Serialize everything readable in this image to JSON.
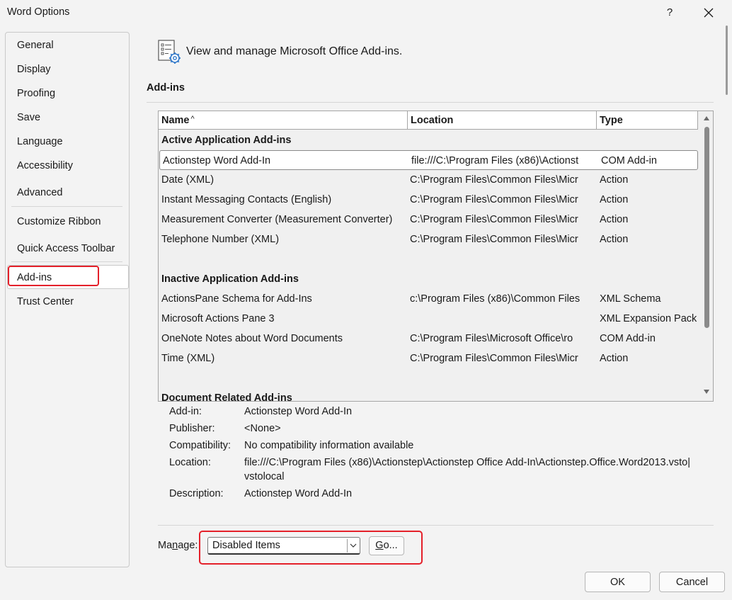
{
  "window": {
    "title": "Word Options",
    "help_label": "?"
  },
  "nav": {
    "items": [
      {
        "label": "General"
      },
      {
        "label": "Display"
      },
      {
        "label": "Proofing"
      },
      {
        "label": "Save"
      },
      {
        "label": "Language"
      },
      {
        "label": "Accessibility"
      },
      {
        "label": "Advanced"
      },
      {
        "label": "Customize Ribbon"
      },
      {
        "label": "Quick Access Toolbar"
      },
      {
        "label": "Add-ins"
      },
      {
        "label": "Trust Center"
      }
    ],
    "selected": "Add-ins"
  },
  "header": {
    "text": "View and manage Microsoft Office Add-ins."
  },
  "section": {
    "title": "Add-ins"
  },
  "table": {
    "columns": {
      "name": "Name",
      "location": "Location",
      "type": "Type",
      "sort_indicator": "^"
    },
    "groups": {
      "active": "Active Application Add-ins",
      "inactive": "Inactive Application Add-ins",
      "document": "Document Related Add-ins"
    },
    "active_rows": [
      {
        "name": "Actionstep Word Add-In",
        "location": "file:///C:\\Program Files (x86)\\Actionst",
        "type": "COM Add-in"
      },
      {
        "name": "Date (XML)",
        "location": "C:\\Program Files\\Common Files\\Micr",
        "type": "Action"
      },
      {
        "name": "Instant Messaging Contacts (English)",
        "location": "C:\\Program Files\\Common Files\\Micr",
        "type": "Action"
      },
      {
        "name": "Measurement Converter (Measurement Converter)",
        "location": "C:\\Program Files\\Common Files\\Micr",
        "type": "Action"
      },
      {
        "name": "Telephone Number (XML)",
        "location": "C:\\Program Files\\Common Files\\Micr",
        "type": "Action"
      }
    ],
    "inactive_rows": [
      {
        "name": "ActionsPane Schema for Add-Ins",
        "location": "c:\\Program Files (x86)\\Common Files",
        "type": "XML Schema"
      },
      {
        "name": "Microsoft Actions Pane 3",
        "location": "",
        "type": "XML Expansion Pack"
      },
      {
        "name": "OneNote Notes about Word Documents",
        "location": "C:\\Program Files\\Microsoft Office\\ro",
        "type": "COM Add-in"
      },
      {
        "name": "Time (XML)",
        "location": "C:\\Program Files\\Common Files\\Micr",
        "type": "Action"
      }
    ]
  },
  "details": {
    "addin_label": "Add-in:",
    "addin_value": "Actionstep Word Add-In",
    "publisher_label": "Publisher:",
    "publisher_value": "<None>",
    "compat_label": "Compatibility:",
    "compat_value": "No compatibility information available",
    "location_label": "Location:",
    "location_value_line1": "file:///C:\\Program Files (x86)\\Actionstep\\Actionstep Office Add-In\\Actionstep.Office.Word2013.vsto|",
    "location_value_line2": "vstolocal",
    "description_label": "Description:",
    "description_value": "Actionstep Word Add-In"
  },
  "manage": {
    "label_pre": "Ma",
    "label_underlined": "n",
    "label_post": "age:",
    "selected_option": "Disabled Items",
    "go_pre": "",
    "go_underlined": "G",
    "go_post": "o..."
  },
  "buttons": {
    "ok": "OK",
    "cancel": "Cancel"
  },
  "colors": {
    "highlight": "#e4202a",
    "background": "#f3f3f3"
  }
}
